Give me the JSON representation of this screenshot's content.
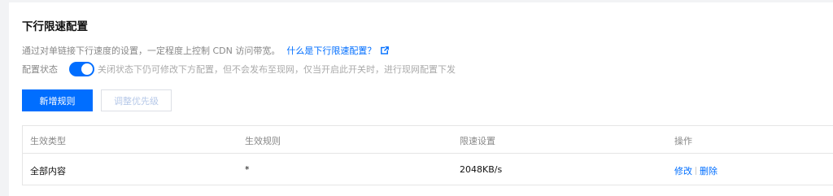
{
  "panel": {
    "title": "下行限速配置",
    "description": "通过对单链接下行速度的设置，一定程度上控制 CDN 访问带宽。",
    "help_link": "什么是下行限速配置？",
    "icons": {
      "help_link_icon": "external-link-icon"
    }
  },
  "status": {
    "label": "配置状态",
    "enabled": true,
    "hint": "关闭状态下仍可修改下方配置，但不会发布至现网，仅当开启此开关时，进行现网配置下发"
  },
  "toolbar": {
    "add_label": "新增规则",
    "priority_label": "调整优先级"
  },
  "table": {
    "columns": [
      "生效类型",
      "生效规则",
      "限速设置",
      "操作"
    ],
    "rows": [
      {
        "type": "全部内容",
        "rule": "*",
        "speed": "2048KB/s",
        "actions": [
          "修改",
          "删除"
        ]
      }
    ]
  },
  "colors": {
    "accent": "#006eff",
    "background": "#f2f3f5",
    "card": "#ffffff"
  }
}
